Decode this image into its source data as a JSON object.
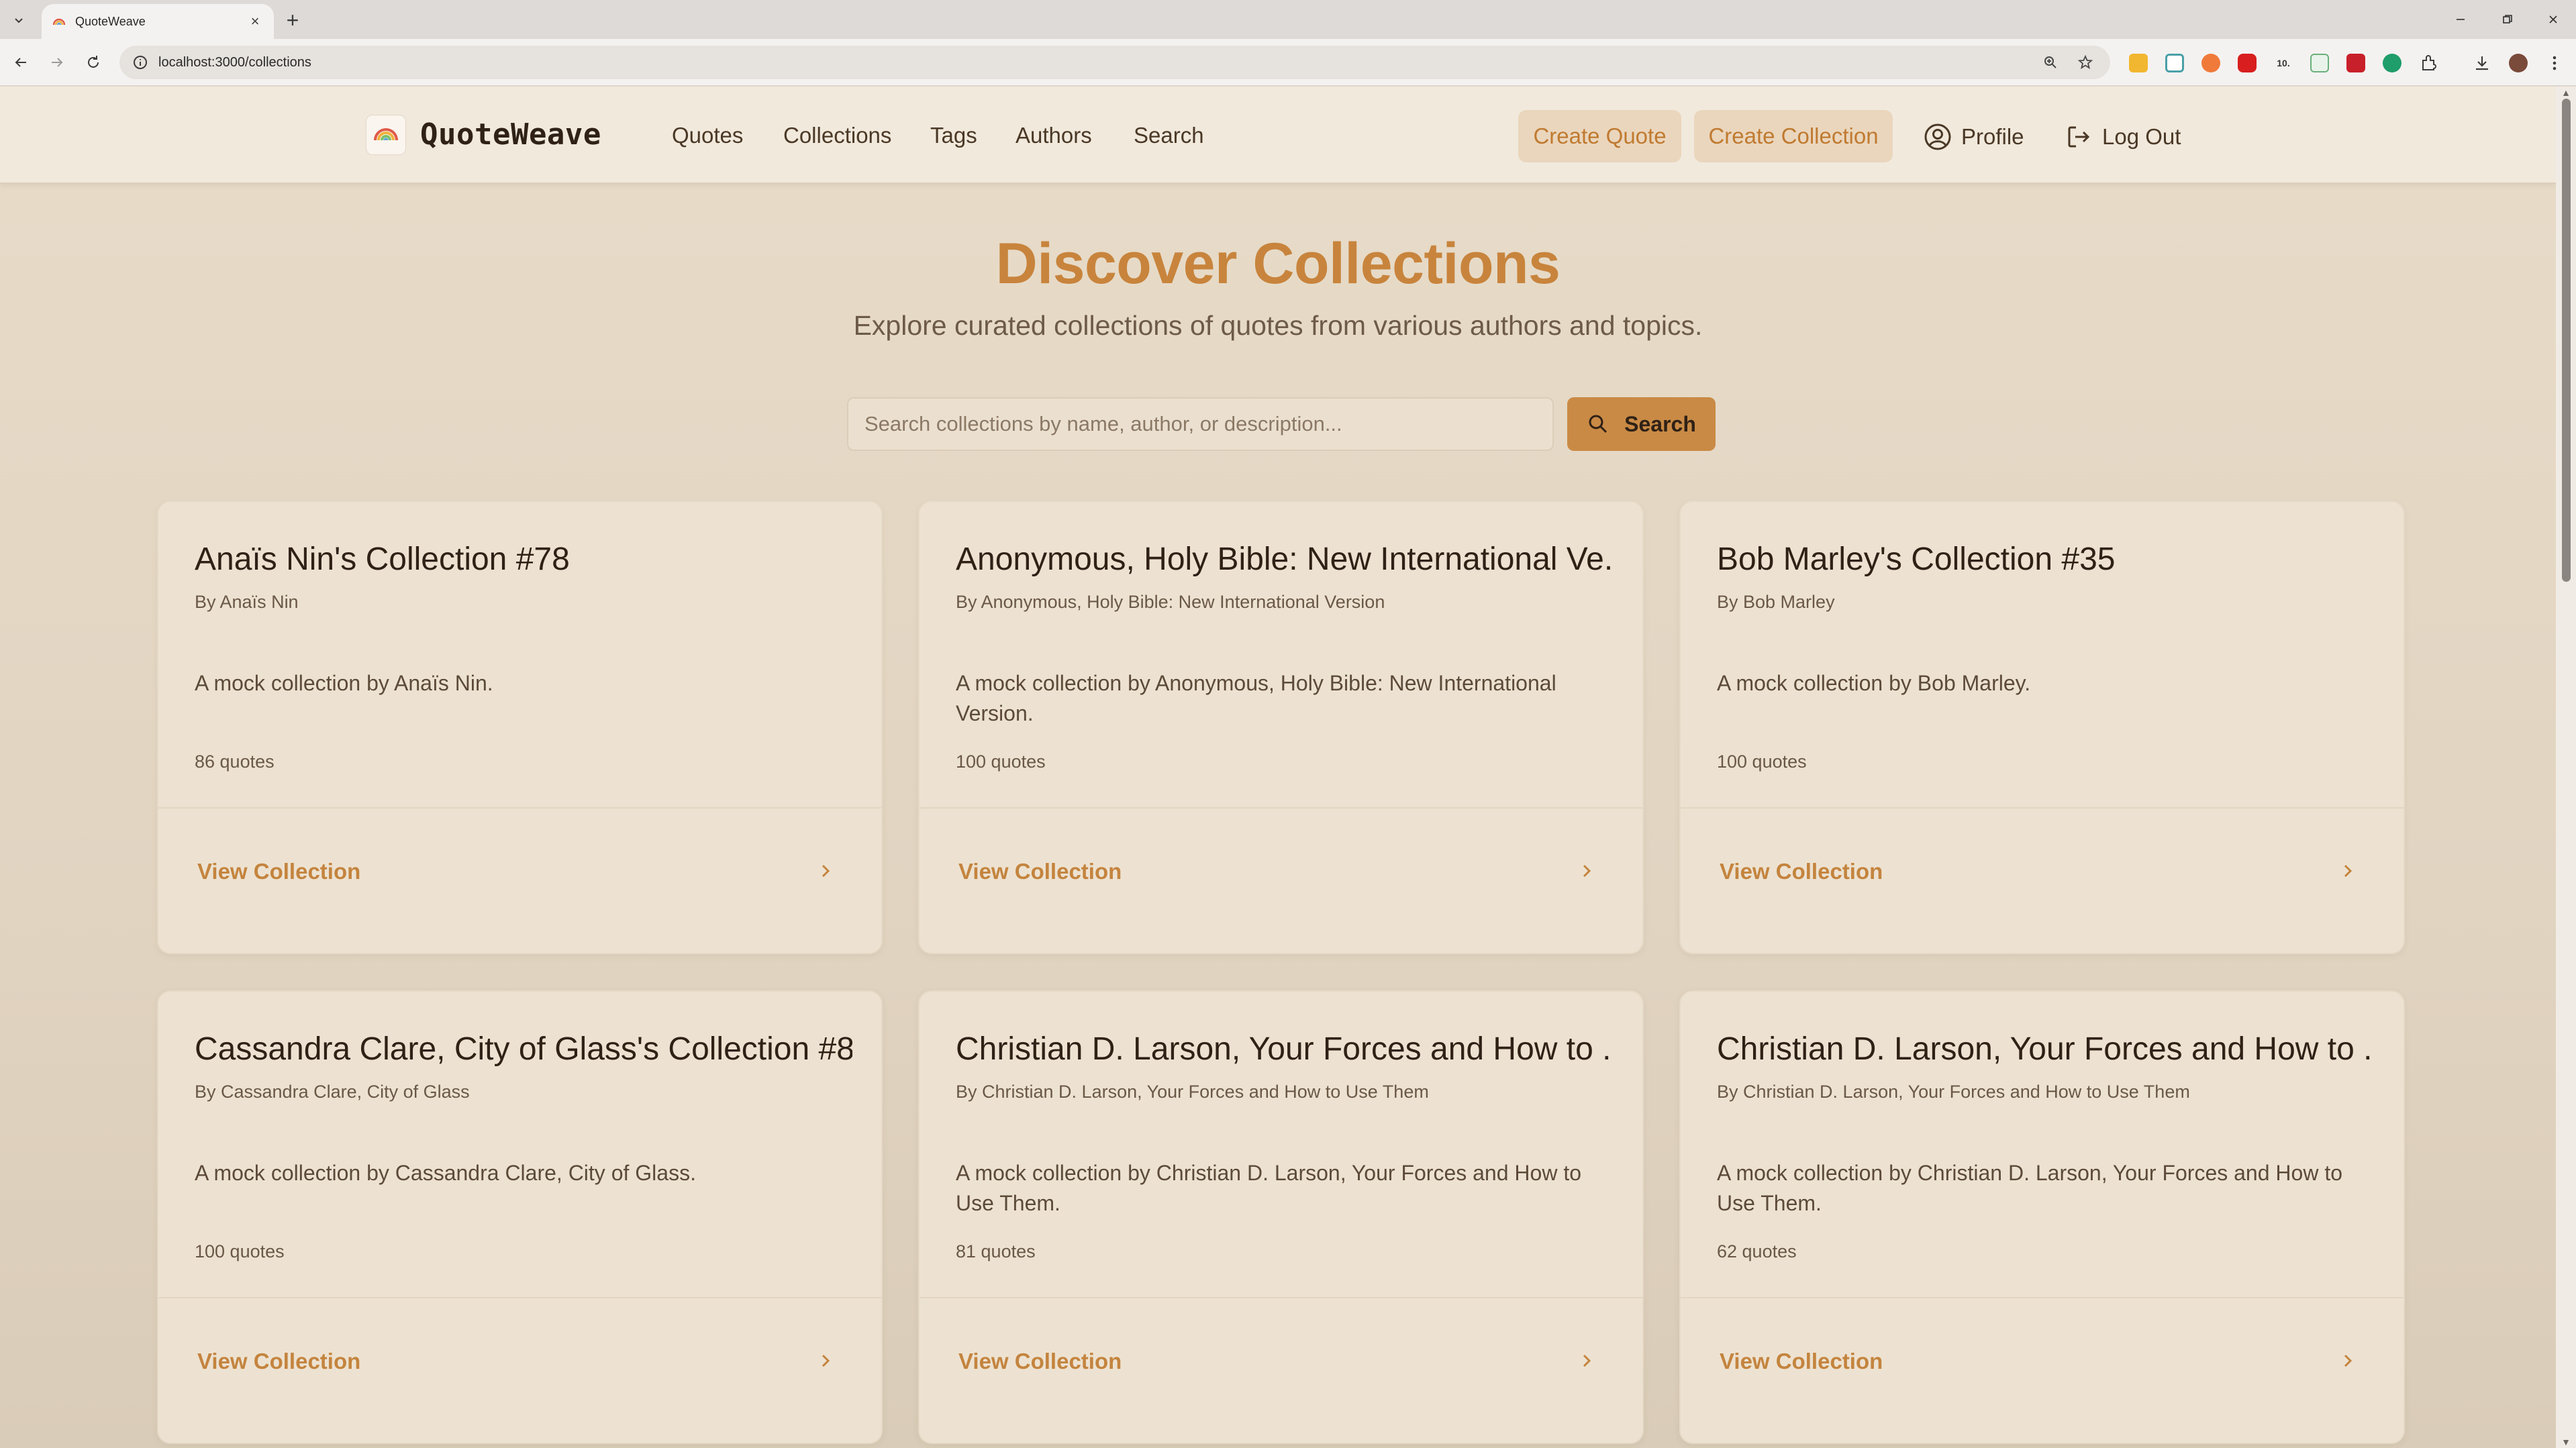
{
  "browser": {
    "tab_title": "QuoteWeave",
    "url": "localhost:3000/collections"
  },
  "header": {
    "brand": "QuoteWeave",
    "nav": [
      {
        "label": "Quotes"
      },
      {
        "label": "Collections"
      },
      {
        "label": "Tags"
      },
      {
        "label": "Authors"
      },
      {
        "label": "Search"
      }
    ],
    "create_quote": "Create Quote",
    "create_collection": "Create Collection",
    "profile": "Profile",
    "logout": "Log Out"
  },
  "hero": {
    "title": "Discover Collections",
    "subtitle": "Explore curated collections of quotes from various authors and topics."
  },
  "search": {
    "placeholder": "Search collections by name, author, or description...",
    "button": "Search"
  },
  "cards": [
    {
      "title": "Anaïs Nin's Collection #78",
      "author": "By Anaïs Nin",
      "desc": "A mock collection by Anaïs Nin.",
      "count": "86 quotes",
      "link": "View Collection"
    },
    {
      "title": "Anonymous, Holy Bible: New International Ve...",
      "author": "By Anonymous, Holy Bible: New International Version",
      "desc": "A mock collection by Anonymous, Holy Bible: New International Version.",
      "count": "100 quotes",
      "link": "View Collection"
    },
    {
      "title": "Bob Marley's Collection #35",
      "author": "By Bob Marley",
      "desc": "A mock collection by Bob Marley.",
      "count": "100 quotes",
      "link": "View Collection"
    },
    {
      "title": "Cassandra Clare, City of Glass's Collection #8",
      "author": "By Cassandra Clare, City of Glass",
      "desc": "A mock collection by Cassandra Clare, City of Glass.",
      "count": "100 quotes",
      "link": "View Collection"
    },
    {
      "title": "Christian D. Larson, Your Forces and How to ...",
      "author": "By Christian D. Larson, Your Forces and How to Use Them",
      "desc": "A mock collection by Christian D. Larson, Your Forces and How to Use Them.",
      "count": "81 quotes",
      "link": "View Collection"
    },
    {
      "title": "Christian D. Larson, Your Forces and How to ...",
      "author": "By Christian D. Larson, Your Forces and How to Use Them",
      "desc": "A mock collection by Christian D. Larson, Your Forces and How to Use Them.",
      "count": "62 quotes",
      "link": "View Collection"
    }
  ],
  "colors": {
    "accent": "#c8843c",
    "page_bg": "#e4d8c6",
    "card_bg": "#ede2d1",
    "button_bg": "#c98a45"
  }
}
